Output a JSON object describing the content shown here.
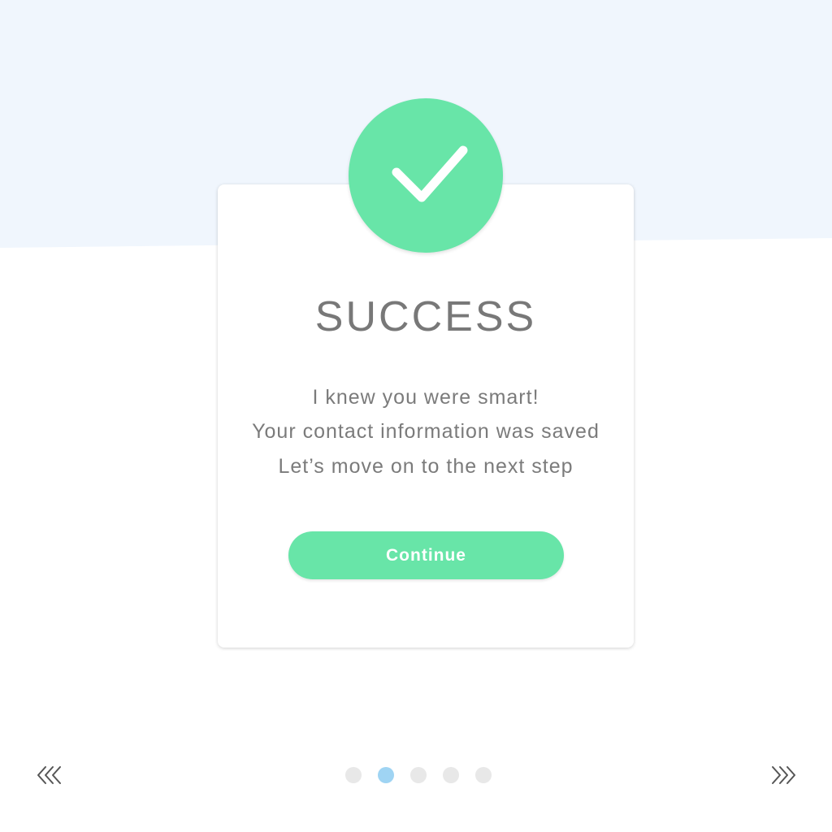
{
  "dialog": {
    "title": "SUCCESS",
    "lines": [
      "I knew you were smart!",
      "Your contact information was saved",
      "Let’s move on to the next step"
    ],
    "continue_label": "Continue",
    "status_icon": "check-icon"
  },
  "pager": {
    "prev_icon": "double-chevron-left-icon",
    "next_icon": "double-chevron-right-icon",
    "total_pages": 5,
    "active_index": 1
  },
  "colors": {
    "accent": "#68e5a8",
    "background_band": "#f0f6fd",
    "text": "#787878",
    "dot_active": "#9fd4f3",
    "dot_inactive": "#e8e8e8"
  }
}
